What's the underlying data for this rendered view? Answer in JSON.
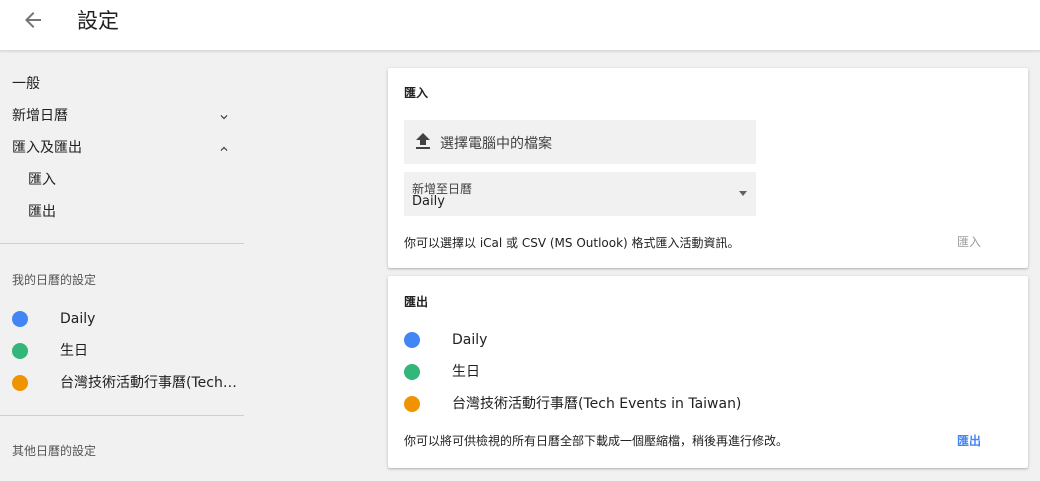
{
  "header": {
    "title": "設定",
    "back_icon": "arrow-back-icon"
  },
  "sidebar": {
    "general": "一般",
    "add_calendar": "新增日曆",
    "import_export": "匯入及匯出",
    "import": "匯入",
    "export": "匯出",
    "my_calendars_heading": "我的日曆的設定",
    "calendars": [
      {
        "name": "Daily",
        "color": "#4285f4"
      },
      {
        "name": "生日",
        "color": "#33b679"
      },
      {
        "name": "台灣技術活動行事曆(Tech ...",
        "color": "#f09300"
      }
    ],
    "other_calendars_heading": "其他日曆的設定"
  },
  "import_card": {
    "title": "匯入",
    "upload_label": "選擇電腦中的檔案",
    "add_to_label": "新增至日曆",
    "add_to_value": "Daily",
    "help": "你可以選擇以 iCal 或 CSV (MS Outlook) 格式匯入活動資訊。",
    "button": "匯入",
    "button_color": "#9e9e9e"
  },
  "export_card": {
    "title": "匯出",
    "calendars": [
      {
        "name": "Daily",
        "color": "#4285f4"
      },
      {
        "name": "生日",
        "color": "#33b679"
      },
      {
        "name": "台灣技術活動行事曆(Tech Events in Taiwan)",
        "color": "#f09300"
      }
    ],
    "help": "你可以將可供檢視的所有日曆全部下載成一個壓縮檔，稍後再進行修改。",
    "button": "匯出",
    "button_color": "#4285f4"
  }
}
